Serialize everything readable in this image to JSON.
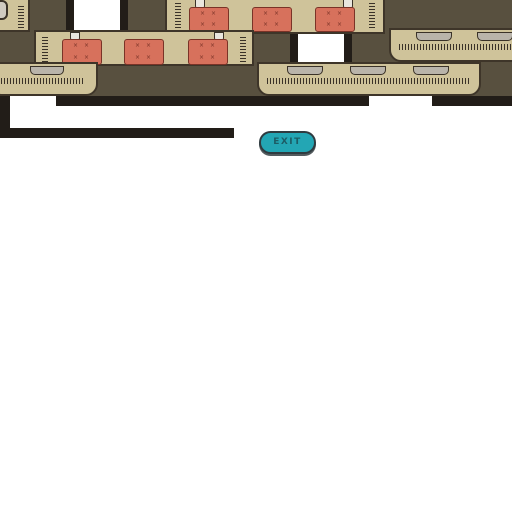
{
  "hud": {
    "exit_label": "EXIT"
  },
  "scene": {
    "background_color": "#ffffff",
    "floor_color": "#58503f",
    "wall_color": "#221d18",
    "couch_color": "#cfc39a",
    "cushion_color": "#d7715c",
    "button_color": "#23a6b4",
    "icons": [
      "couch-sprite",
      "cushion-sprite",
      "table-leg-sprite",
      "robot-part-sprite"
    ]
  }
}
